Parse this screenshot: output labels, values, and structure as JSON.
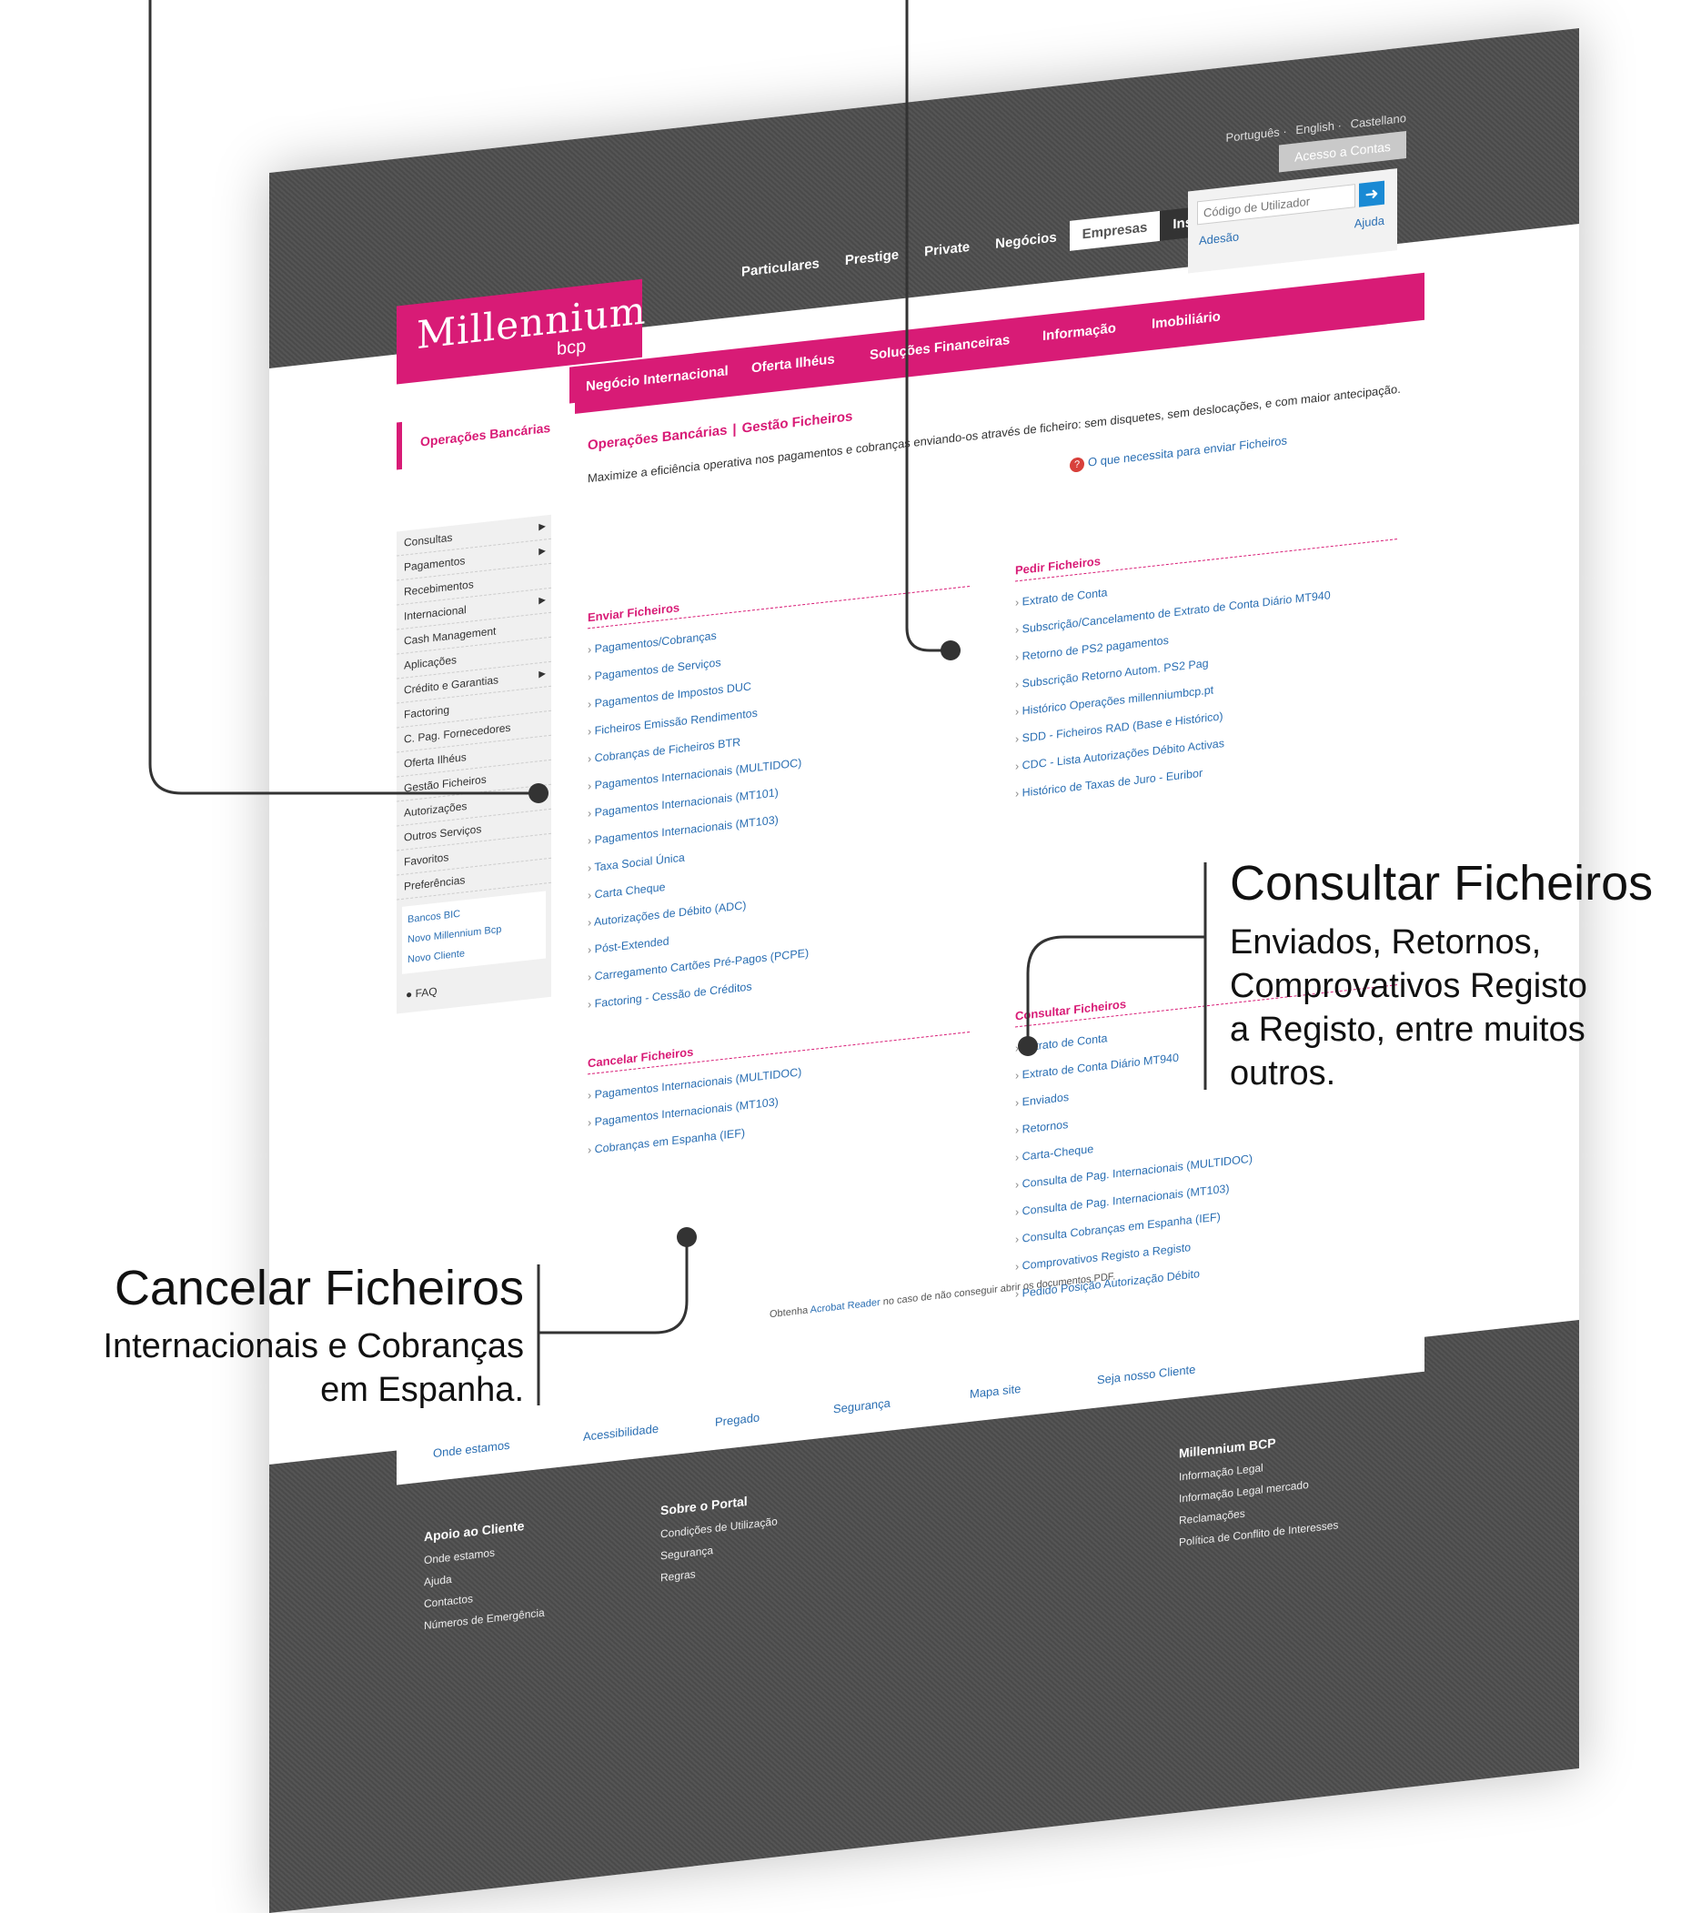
{
  "top": {
    "languages": [
      "Português",
      "English",
      "Castellano"
    ],
    "access_tab": "Acesso a Contas",
    "segments": [
      "Particulares",
      "Prestige",
      "Private",
      "Negócios",
      "Empresas",
      "Institucional"
    ],
    "login_placeholder": "Código de Utilizador",
    "login_go": "➜",
    "adesao": "Adesão",
    "ajuda": "Ajuda"
  },
  "logo": {
    "word": "Millennium",
    "sub": "bcp"
  },
  "menu": [
    "Operações Bancárias",
    "Negócio Internacional",
    "Oferta Ilhéus",
    "Soluções Financeiras",
    "Informação",
    "Imobiliário"
  ],
  "breadcrumb": {
    "first": "Operações Bancárias",
    "second": "Gestão Ficheiros"
  },
  "description": "Maximize a eficiência operativa nos pagamentos e cobranças enviando-os através de ficheiro: sem disquetes, sem deslocações, e com maior antecipação.",
  "help_link": "O que necessita para enviar Ficheiros",
  "sidebar": {
    "items": [
      {
        "label": "Consultas",
        "arrow": true
      },
      {
        "label": "Pagamentos",
        "arrow": true
      },
      {
        "label": "Recebimentos",
        "arrow": false
      },
      {
        "label": "Internacional",
        "arrow": true
      },
      {
        "label": "Cash Management",
        "arrow": false
      },
      {
        "label": "Aplicações",
        "arrow": false
      },
      {
        "label": "Crédito e Garantias",
        "arrow": true
      },
      {
        "label": "Factoring",
        "arrow": false
      },
      {
        "label": "C. Pag. Fornecedores",
        "arrow": false
      },
      {
        "label": "Oferta Ilhéus",
        "arrow": false
      },
      {
        "label": "Gestão Ficheiros",
        "arrow": false
      },
      {
        "label": "Autorizações",
        "arrow": true
      },
      {
        "label": "Outros Serviços",
        "arrow": false
      },
      {
        "label": "Favoritos",
        "arrow": false
      },
      {
        "label": "Preferências",
        "arrow": false
      }
    ],
    "external": [
      "Bancos BIC",
      "Novo Millennium Bcp",
      "Novo Cliente"
    ],
    "faq": "FAQ"
  },
  "sections": {
    "enviar": {
      "title": "Enviar Ficheiros",
      "links": [
        "Pagamentos/Cobranças",
        "Pagamentos de Serviços",
        "Pagamentos de Impostos DUC",
        "Ficheiros Emissão Rendimentos",
        "Cobranças de Ficheiros BTR",
        "Pagamentos Internacionais (MULTIDOC)",
        "Pagamentos Internacionais (MT101)",
        "Pagamentos Internacionais (MT103)",
        "Taxa Social Única",
        "Carta Cheque",
        "Autorizações de Débito (ADC)",
        "Póst-Extended",
        "Carregamento Cartões Pré-Pagos (PCPE)",
        "Factoring - Cessão de Créditos"
      ]
    },
    "pedir": {
      "title": "Pedir Ficheiros",
      "links": [
        "Extrato de Conta",
        "Subscrição/Cancelamento de Extrato de Conta Diário MT940",
        "Retorno de PS2 pagamentos",
        "Subscrição Retorno Autom. PS2 Pag",
        "Histórico Operações millenniumbcp.pt",
        "SDD - Ficheiros RAD (Base e Histórico)",
        "CDC - Lista Autorizações Débito Activas",
        "Histórico de Taxas de Juro - Euribor"
      ]
    },
    "cancelar": {
      "title": "Cancelar Ficheiros",
      "links": [
        "Pagamentos Internacionais (MULTIDOC)",
        "Pagamentos Internacionais (MT103)",
        "Cobranças em Espanha (IEF)"
      ]
    },
    "consultar": {
      "title": "Consultar Ficheiros",
      "links": [
        "Extrato de Conta",
        "Extrato de Conta Diário MT940",
        "Enviados",
        "Retornos",
        "Carta-Cheque",
        "Consulta de Pag. Internacionais (MULTIDOC)",
        "Consulta de Pag. Internacionais (MT103)",
        "Consulta Cobranças em Espanha (IEF)",
        "Comprovativos Registo a Registo",
        "Pedido Posição Autorização Débito"
      ]
    }
  },
  "note": {
    "prefix": "Obtenha ",
    "link": "Acrobat Reader",
    "suffix": " no caso de não conseguir abrir os documentos PDF."
  },
  "footer_links": [
    "Onde estamos",
    "Acessibilidade",
    "Pregado",
    "Segurança",
    "Mapa site",
    "Seja nosso Cliente"
  ],
  "footer_cols": [
    {
      "title": "Apoio ao Cliente",
      "items": [
        "Onde estamos",
        "Ajuda",
        "Contactos",
        "Números de Emergência"
      ]
    },
    {
      "title": "Sobre o Portal",
      "items": [
        "Condições de Utilização",
        "Segurança",
        "Regras"
      ]
    },
    {
      "title": "Millennium BCP",
      "items": [
        "Informação Legal",
        "Informação Legal mercado",
        "Reclamações",
        "Política de Conflito de Interesses"
      ]
    }
  ],
  "annotations": {
    "consultar": {
      "title": "Consultar Ficheiros",
      "lines": [
        "Enviados, Retornos,",
        "Comprovativos  Registo",
        "a Registo, entre muitos",
        "outros."
      ]
    },
    "cancelar": {
      "title": "Cancelar Ficheiros",
      "lines": [
        "Internacionais e Cobranças",
        "em Espanha."
      ]
    }
  },
  "colors": {
    "brand": "#d81b76",
    "link": "#2b6fb3",
    "dark": "#4a4a4a"
  }
}
